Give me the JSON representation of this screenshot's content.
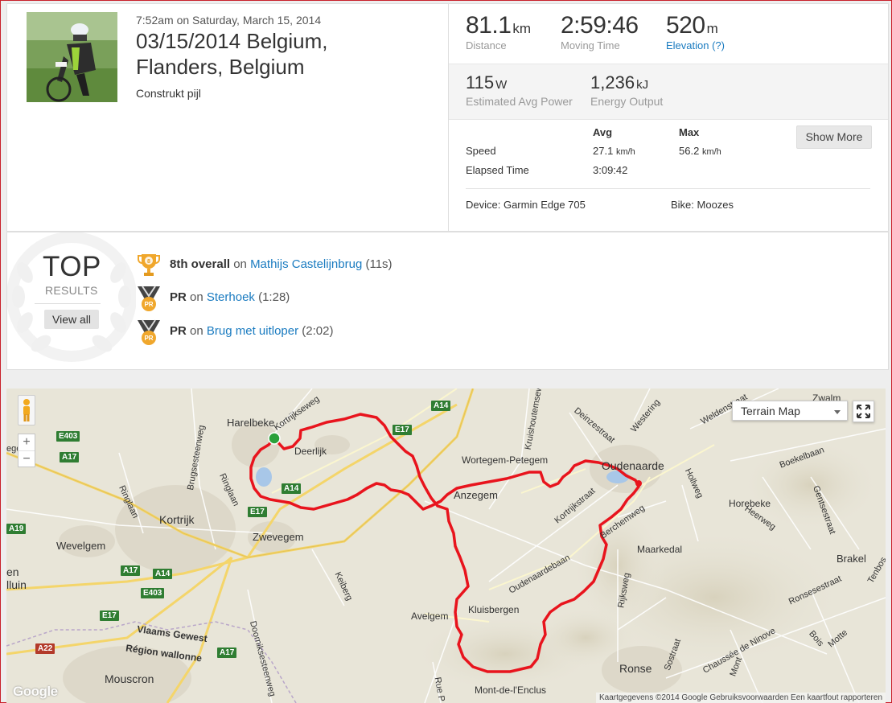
{
  "activity": {
    "date": "7:52am on Saturday, March 15, 2014",
    "title": "03/15/2014 Belgium, Flanders, Belgium",
    "gear": "Construkt pijl"
  },
  "stats": {
    "distance": {
      "value": "81.1",
      "unit": "km",
      "label": "Distance"
    },
    "moving_time": {
      "value": "2:59:46",
      "label": "Moving Time"
    },
    "elevation": {
      "value": "520",
      "unit": "m",
      "label": "Elevation (?)"
    },
    "power": {
      "value": "115",
      "unit": "W",
      "label": "Estimated Avg Power"
    },
    "energy": {
      "value": "1,236",
      "unit": "kJ",
      "label": "Energy Output"
    },
    "table": {
      "avg_header": "Avg",
      "max_header": "Max",
      "speed_label": "Speed",
      "speed_avg": "27.1",
      "speed_max": "56.2",
      "speed_unit": "km/h",
      "elapsed_label": "Elapsed Time",
      "elapsed_avg": "3:09:42"
    },
    "show_more": "Show More",
    "device": "Device: Garmin Edge 705",
    "bike": "Bike: Moozes"
  },
  "results": {
    "top": "TOP",
    "results": "RESULTS",
    "view_all": "View all",
    "items": [
      {
        "badge": "8th overall",
        "on": "on",
        "segment": "Mathijs Castelijnbrug",
        "time": "(11s)",
        "icon": "trophy-icon"
      },
      {
        "badge": "PR",
        "on": "on",
        "segment": "Sterhoek",
        "time": "(1:28)",
        "icon": "pr-medal-icon"
      },
      {
        "badge": "PR",
        "on": "on",
        "segment": "Brug met uitloper",
        "time": "(2:02)",
        "icon": "pr-medal-icon"
      }
    ]
  },
  "map": {
    "type_label": "Terrain Map",
    "zoom_in": "+",
    "zoom_out": "−",
    "attribution": "Kaartgegevens ©2014 Google   Gebruiksvoorwaarden   Een kaartfout rapporteren",
    "google": "Google",
    "places": {
      "harelbeke": "Harelbeke",
      "deerlijk": "Deerlijk",
      "kortrijk": "Kortrijk",
      "zwevegem": "Zwevegem",
      "wevelgem": "Wevelgem",
      "anzegem": "Anzegem",
      "wortegem": "Wortegem-Petegem",
      "oudenaarde": "Oudenaarde",
      "kluisbergen": "Kluisbergen",
      "avelgem": "Avelgem",
      "ronse": "Ronse",
      "mouscron": "Mouscron",
      "maarkedal": "Maarkedal",
      "horebeke": "Horebeke",
      "brakel": "Brakel",
      "zwalm": "Zwalm",
      "mont": "Mont-de-l'Enclus",
      "vlaams": "Vlaams Gewest",
      "wallonne": "Région wallonne",
      "lluin": "lluin",
      "en": "en",
      "ege": "ege"
    },
    "roads": {
      "kortrijkseweg": "Kortrijkseweg",
      "brugsesteenweg": "Brugsesteenweg",
      "ringlaan": "Ringlaan",
      "ringlaan2": "Ringlaan",
      "kruishoutemse": "Kruishoutemsew",
      "deinzestraat": "Deinzestraat",
      "westering": "Westering",
      "weldenstraat": "Weldenstraat",
      "boekelbaan": "Boekelbaan",
      "hollewg": "Hollweg",
      "gentsestraat": "Gentsestraat",
      "heerweg": "Heerweg",
      "kortrijkstraat": "Kortrijkstraat",
      "berchemweg": "Berchemweg",
      "oudenaardebaan": "Oudenaardebaan",
      "rijksweg": "Rijksweg",
      "keiberg": "Keiberg",
      "doornik": "Doorniksesteenweg",
      "ronsesestraat": "Ronsesestraat",
      "ninove": "Chaussée de Ninove",
      "bois": "Bois",
      "motte": "Motte",
      "mont2": "Mont",
      "postraat": "Sostraat",
      "rue": "Rue P",
      "tenbos": "Tenbos"
    },
    "shields": {
      "a14a": "A14",
      "a14b": "A14",
      "a14c": "A14",
      "e17a": "E17",
      "e17b": "E17",
      "e17c": "E17",
      "e403a": "E403",
      "e403b": "E403",
      "a17a": "A17",
      "a17b": "A17",
      "a17c": "A17",
      "a19": "A19",
      "a22": "A22"
    },
    "colors": {
      "route": "#e8141d",
      "start": "#2aa13b"
    }
  }
}
